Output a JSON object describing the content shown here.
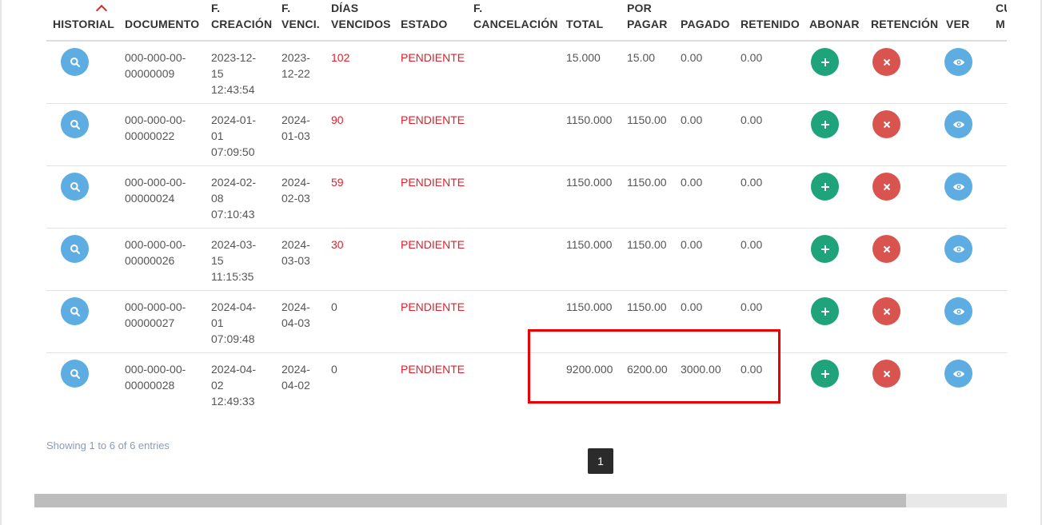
{
  "table": {
    "headers": [
      {
        "line1": "",
        "line2": "HISTORIAL"
      },
      {
        "line1": "",
        "line2": "DOCUMENTO"
      },
      {
        "line1": "F.",
        "line2": "CREACIÓN"
      },
      {
        "line1": "F.",
        "line2": "VENCI."
      },
      {
        "line1": "DÍAS",
        "line2": "VENCIDOS"
      },
      {
        "line1": "",
        "line2": "ESTADO"
      },
      {
        "line1": "F.",
        "line2": "CANCELACIÓN"
      },
      {
        "line1": "",
        "line2": "TOTAL"
      },
      {
        "line1": "POR",
        "line2": "PAGAR"
      },
      {
        "line1": "",
        "line2": "PAGADO"
      },
      {
        "line1": "",
        "line2": "RETENIDO"
      },
      {
        "line1": "",
        "line2": "ABONAR"
      },
      {
        "line1": "",
        "line2": "RETENCIÓN"
      },
      {
        "line1": "",
        "line2": "VER"
      },
      {
        "line1": "CU",
        "line2": "M"
      }
    ],
    "rows": [
      {
        "doc1": "000-000-00-",
        "doc2": "00000009",
        "cre1": "2023-12-",
        "cre2": "15",
        "cre3": "12:43:54",
        "ven1": "2023-",
        "ven2": "12-22",
        "dias": "102",
        "estado": "PENDIENTE",
        "cancel": "",
        "total": "15.000",
        "por_pagar": "15.00",
        "pagado": "0.00",
        "retenido": "0.00"
      },
      {
        "doc1": "000-000-00-",
        "doc2": "00000022",
        "cre1": "2024-01-",
        "cre2": "01",
        "cre3": "07:09:50",
        "ven1": "2024-",
        "ven2": "01-03",
        "dias": "90",
        "estado": "PENDIENTE",
        "cancel": "",
        "total": "1150.000",
        "por_pagar": "1150.00",
        "pagado": "0.00",
        "retenido": "0.00"
      },
      {
        "doc1": "000-000-00-",
        "doc2": "00000024",
        "cre1": "2024-02-",
        "cre2": "08",
        "cre3": "07:10:43",
        "ven1": "2024-",
        "ven2": "02-03",
        "dias": "59",
        "estado": "PENDIENTE",
        "cancel": "",
        "total": "1150.000",
        "por_pagar": "1150.00",
        "pagado": "0.00",
        "retenido": "0.00"
      },
      {
        "doc1": "000-000-00-",
        "doc2": "00000026",
        "cre1": "2024-03-",
        "cre2": "15",
        "cre3": "11:15:35",
        "ven1": "2024-",
        "ven2": "03-03",
        "dias": "30",
        "estado": "PENDIENTE",
        "cancel": "",
        "total": "1150.000",
        "por_pagar": "1150.00",
        "pagado": "0.00",
        "retenido": "0.00"
      },
      {
        "doc1": "000-000-00-",
        "doc2": "00000027",
        "cre1": "2024-04-",
        "cre2": "01",
        "cre3": "07:09:48",
        "ven1": "2024-",
        "ven2": "04-03",
        "dias": "0",
        "estado": "PENDIENTE",
        "cancel": "",
        "total": "1150.000",
        "por_pagar": "1150.00",
        "pagado": "0.00",
        "retenido": "0.00"
      },
      {
        "doc1": "000-000-00-",
        "doc2": "00000028",
        "cre1": "2024-04-",
        "cre2": "02",
        "cre3": "12:49:33",
        "ven1": "2024-",
        "ven2": "04-02",
        "dias": "0",
        "estado": "PENDIENTE",
        "cancel": "",
        "total": "9200.000",
        "por_pagar": "6200.00",
        "pagado": "3000.00",
        "retenido": "0.00"
      }
    ]
  },
  "footer": {
    "showing": "Showing 1 to 6 of 6 entries",
    "page": "1"
  },
  "colors": {
    "accent_red": "#e0202c",
    "btn_blue": "#5dade2",
    "btn_green": "#1fa37a",
    "btn_red": "#d9534f",
    "highlight": "#ee0000"
  },
  "icons": {
    "historial": "search-icon",
    "abonar": "plus-icon",
    "retencion": "close-icon",
    "ver": "eye-icon"
  }
}
